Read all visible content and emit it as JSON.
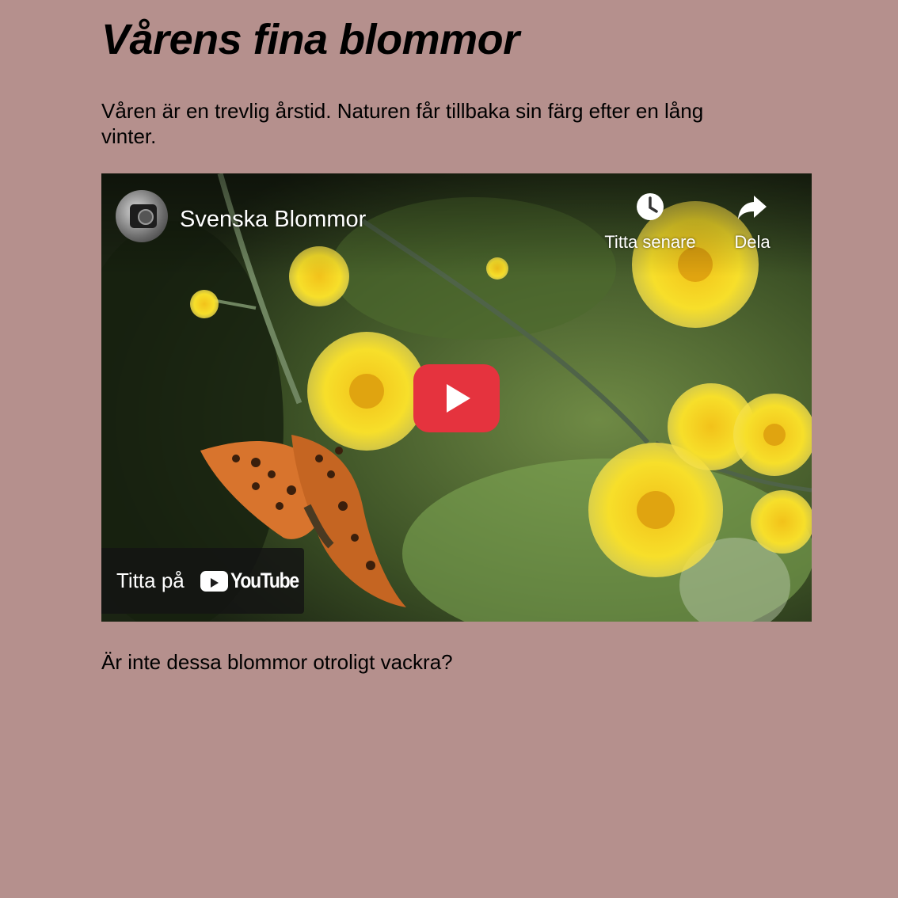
{
  "page": {
    "heading": "Vårens fina blommor",
    "intro": "Våren är en trevlig årstid. Naturen får tillbaka sin färg efter en lång vinter.",
    "outro": "Är inte dessa blommor otroligt vackra?",
    "background_color": "#b5908d"
  },
  "video": {
    "channel_avatar_icon": "camera-avatar-icon",
    "title": "Svenska Blommor",
    "watch_later_label": "Titta senare",
    "watch_later_icon": "clock-icon",
    "share_label": "Dela",
    "share_icon": "share-arrow-icon",
    "play_icon": "play-icon",
    "play_button_color": "#e5333e",
    "watch_on_label": "Titta på",
    "youtube_logo_text": "YouTube"
  }
}
